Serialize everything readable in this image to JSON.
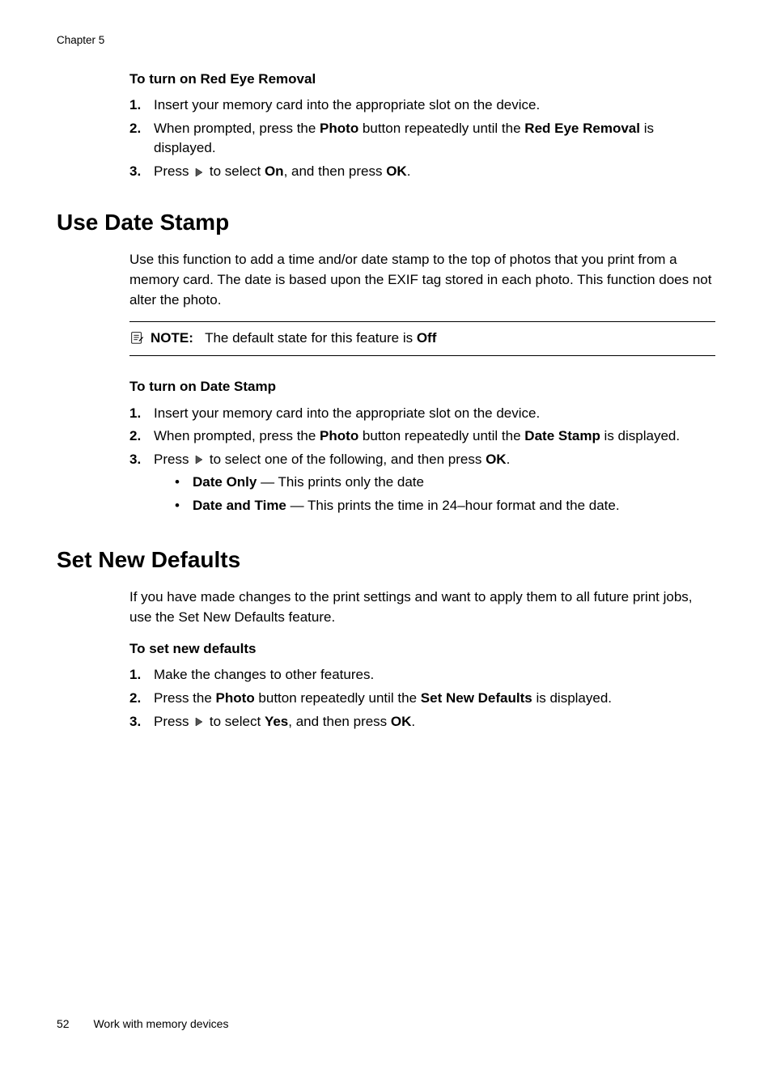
{
  "chapter_label": "Chapter 5",
  "section_redeye": {
    "subheading": "To turn on Red Eye Removal",
    "steps": [
      {
        "num": "1.",
        "pre": "Insert your memory card into the appropriate slot on the device."
      },
      {
        "num": "2.",
        "pre": "When prompted, press the ",
        "b1": "Photo",
        "mid": " button repeatedly until the ",
        "b2": "Red Eye Removal",
        "post": " is displayed."
      },
      {
        "num": "3.",
        "pre": "Press ",
        "mid": " to select ",
        "b1": "On",
        "mid2": ", and then press ",
        "b2": "OK",
        "post": "."
      }
    ]
  },
  "section_datestamp": {
    "heading": "Use Date Stamp",
    "intro": "Use this function to add a time and/or date stamp to the top of photos that you print from a memory card. The date is based upon the EXIF tag stored in each photo. This function does not alter the photo.",
    "note_label": "NOTE:",
    "note_body_pre": "The default state for this feature is ",
    "note_body_bold": "Off",
    "subheading": "To turn on Date Stamp",
    "steps": [
      {
        "num": "1.",
        "pre": "Insert your memory card into the appropriate slot on the device."
      },
      {
        "num": "2.",
        "pre": "When prompted, press the ",
        "b1": "Photo",
        "mid": " button repeatedly until the ",
        "b2": "Date Stamp",
        "post": " is displayed."
      },
      {
        "num": "3.",
        "pre": "Press ",
        "mid": " to select one of the following, and then press ",
        "b1": "OK",
        "post": "."
      }
    ],
    "bullets": [
      {
        "b": "Date Only",
        "rest": " — This prints only the date"
      },
      {
        "b": "Date and Time",
        "rest": " — This prints the time in 24–hour format and the date."
      }
    ]
  },
  "section_defaults": {
    "heading": "Set New Defaults",
    "intro": "If you have made changes to the print settings and want to apply them to all future print jobs, use the Set New Defaults feature.",
    "subheading": "To set new defaults",
    "steps": [
      {
        "num": "1.",
        "pre": "Make the changes to other features."
      },
      {
        "num": "2.",
        "pre": "Press the ",
        "b1": "Photo",
        "mid": " button repeatedly until the ",
        "b2": "Set New Defaults",
        "post": " is displayed."
      },
      {
        "num": "3.",
        "pre": "Press ",
        "mid": " to select ",
        "b1": "Yes",
        "mid2": ", and then press ",
        "b2": "OK",
        "post": "."
      }
    ]
  },
  "footer": {
    "page": "52",
    "title": "Work with memory devices"
  }
}
